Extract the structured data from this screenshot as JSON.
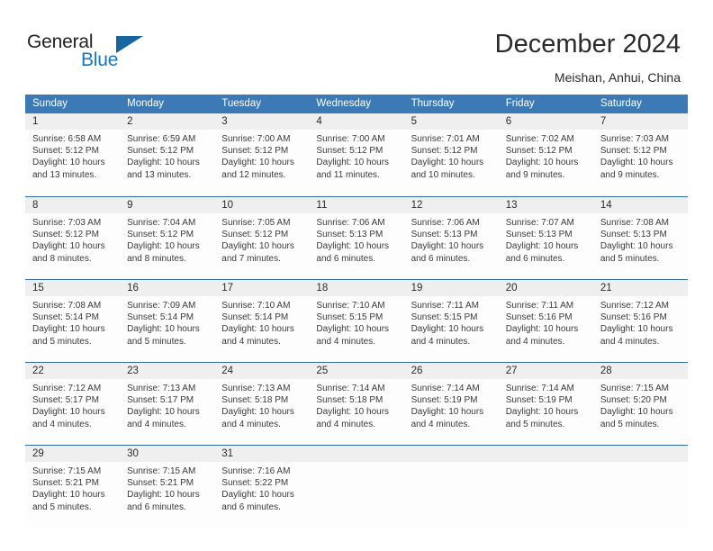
{
  "brand": {
    "line1": "General",
    "line2": "Blue",
    "triangle_color": "#16659f",
    "blue_color": "#1577c4"
  },
  "header": {
    "title": "December 2024",
    "subtitle": "Meishan, Anhui, China"
  },
  "theme": {
    "header_blue": "#3b7ab4",
    "row_rule_blue": "#2e6ca4",
    "date_band": "#efefef"
  },
  "weekdays": [
    "Sunday",
    "Monday",
    "Tuesday",
    "Wednesday",
    "Thursday",
    "Friday",
    "Saturday"
  ],
  "weeks": [
    [
      {
        "day": "1",
        "sunrise": "Sunrise: 6:58 AM",
        "sunset": "Sunset: 5:12 PM",
        "daylight1": "Daylight: 10 hours",
        "daylight2": "and 13 minutes."
      },
      {
        "day": "2",
        "sunrise": "Sunrise: 6:59 AM",
        "sunset": "Sunset: 5:12 PM",
        "daylight1": "Daylight: 10 hours",
        "daylight2": "and 13 minutes."
      },
      {
        "day": "3",
        "sunrise": "Sunrise: 7:00 AM",
        "sunset": "Sunset: 5:12 PM",
        "daylight1": "Daylight: 10 hours",
        "daylight2": "and 12 minutes."
      },
      {
        "day": "4",
        "sunrise": "Sunrise: 7:00 AM",
        "sunset": "Sunset: 5:12 PM",
        "daylight1": "Daylight: 10 hours",
        "daylight2": "and 11 minutes."
      },
      {
        "day": "5",
        "sunrise": "Sunrise: 7:01 AM",
        "sunset": "Sunset: 5:12 PM",
        "daylight1": "Daylight: 10 hours",
        "daylight2": "and 10 minutes."
      },
      {
        "day": "6",
        "sunrise": "Sunrise: 7:02 AM",
        "sunset": "Sunset: 5:12 PM",
        "daylight1": "Daylight: 10 hours",
        "daylight2": "and 9 minutes."
      },
      {
        "day": "7",
        "sunrise": "Sunrise: 7:03 AM",
        "sunset": "Sunset: 5:12 PM",
        "daylight1": "Daylight: 10 hours",
        "daylight2": "and 9 minutes."
      }
    ],
    [
      {
        "day": "8",
        "sunrise": "Sunrise: 7:03 AM",
        "sunset": "Sunset: 5:12 PM",
        "daylight1": "Daylight: 10 hours",
        "daylight2": "and 8 minutes."
      },
      {
        "day": "9",
        "sunrise": "Sunrise: 7:04 AM",
        "sunset": "Sunset: 5:12 PM",
        "daylight1": "Daylight: 10 hours",
        "daylight2": "and 8 minutes."
      },
      {
        "day": "10",
        "sunrise": "Sunrise: 7:05 AM",
        "sunset": "Sunset: 5:12 PM",
        "daylight1": "Daylight: 10 hours",
        "daylight2": "and 7 minutes."
      },
      {
        "day": "11",
        "sunrise": "Sunrise: 7:06 AM",
        "sunset": "Sunset: 5:13 PM",
        "daylight1": "Daylight: 10 hours",
        "daylight2": "and 6 minutes."
      },
      {
        "day": "12",
        "sunrise": "Sunrise: 7:06 AM",
        "sunset": "Sunset: 5:13 PM",
        "daylight1": "Daylight: 10 hours",
        "daylight2": "and 6 minutes."
      },
      {
        "day": "13",
        "sunrise": "Sunrise: 7:07 AM",
        "sunset": "Sunset: 5:13 PM",
        "daylight1": "Daylight: 10 hours",
        "daylight2": "and 6 minutes."
      },
      {
        "day": "14",
        "sunrise": "Sunrise: 7:08 AM",
        "sunset": "Sunset: 5:13 PM",
        "daylight1": "Daylight: 10 hours",
        "daylight2": "and 5 minutes."
      }
    ],
    [
      {
        "day": "15",
        "sunrise": "Sunrise: 7:08 AM",
        "sunset": "Sunset: 5:14 PM",
        "daylight1": "Daylight: 10 hours",
        "daylight2": "and 5 minutes."
      },
      {
        "day": "16",
        "sunrise": "Sunrise: 7:09 AM",
        "sunset": "Sunset: 5:14 PM",
        "daylight1": "Daylight: 10 hours",
        "daylight2": "and 5 minutes."
      },
      {
        "day": "17",
        "sunrise": "Sunrise: 7:10 AM",
        "sunset": "Sunset: 5:14 PM",
        "daylight1": "Daylight: 10 hours",
        "daylight2": "and 4 minutes."
      },
      {
        "day": "18",
        "sunrise": "Sunrise: 7:10 AM",
        "sunset": "Sunset: 5:15 PM",
        "daylight1": "Daylight: 10 hours",
        "daylight2": "and 4 minutes."
      },
      {
        "day": "19",
        "sunrise": "Sunrise: 7:11 AM",
        "sunset": "Sunset: 5:15 PM",
        "daylight1": "Daylight: 10 hours",
        "daylight2": "and 4 minutes."
      },
      {
        "day": "20",
        "sunrise": "Sunrise: 7:11 AM",
        "sunset": "Sunset: 5:16 PM",
        "daylight1": "Daylight: 10 hours",
        "daylight2": "and 4 minutes."
      },
      {
        "day": "21",
        "sunrise": "Sunrise: 7:12 AM",
        "sunset": "Sunset: 5:16 PM",
        "daylight1": "Daylight: 10 hours",
        "daylight2": "and 4 minutes."
      }
    ],
    [
      {
        "day": "22",
        "sunrise": "Sunrise: 7:12 AM",
        "sunset": "Sunset: 5:17 PM",
        "daylight1": "Daylight: 10 hours",
        "daylight2": "and 4 minutes."
      },
      {
        "day": "23",
        "sunrise": "Sunrise: 7:13 AM",
        "sunset": "Sunset: 5:17 PM",
        "daylight1": "Daylight: 10 hours",
        "daylight2": "and 4 minutes."
      },
      {
        "day": "24",
        "sunrise": "Sunrise: 7:13 AM",
        "sunset": "Sunset: 5:18 PM",
        "daylight1": "Daylight: 10 hours",
        "daylight2": "and 4 minutes."
      },
      {
        "day": "25",
        "sunrise": "Sunrise: 7:14 AM",
        "sunset": "Sunset: 5:18 PM",
        "daylight1": "Daylight: 10 hours",
        "daylight2": "and 4 minutes."
      },
      {
        "day": "26",
        "sunrise": "Sunrise: 7:14 AM",
        "sunset": "Sunset: 5:19 PM",
        "daylight1": "Daylight: 10 hours",
        "daylight2": "and 4 minutes."
      },
      {
        "day": "27",
        "sunrise": "Sunrise: 7:14 AM",
        "sunset": "Sunset: 5:19 PM",
        "daylight1": "Daylight: 10 hours",
        "daylight2": "and 5 minutes."
      },
      {
        "day": "28",
        "sunrise": "Sunrise: 7:15 AM",
        "sunset": "Sunset: 5:20 PM",
        "daylight1": "Daylight: 10 hours",
        "daylight2": "and 5 minutes."
      }
    ],
    [
      {
        "day": "29",
        "sunrise": "Sunrise: 7:15 AM",
        "sunset": "Sunset: 5:21 PM",
        "daylight1": "Daylight: 10 hours",
        "daylight2": "and 5 minutes."
      },
      {
        "day": "30",
        "sunrise": "Sunrise: 7:15 AM",
        "sunset": "Sunset: 5:21 PM",
        "daylight1": "Daylight: 10 hours",
        "daylight2": "and 6 minutes."
      },
      {
        "day": "31",
        "sunrise": "Sunrise: 7:16 AM",
        "sunset": "Sunset: 5:22 PM",
        "daylight1": "Daylight: 10 hours",
        "daylight2": "and 6 minutes."
      },
      {
        "day": "",
        "sunrise": "",
        "sunset": "",
        "daylight1": "",
        "daylight2": ""
      },
      {
        "day": "",
        "sunrise": "",
        "sunset": "",
        "daylight1": "",
        "daylight2": ""
      },
      {
        "day": "",
        "sunrise": "",
        "sunset": "",
        "daylight1": "",
        "daylight2": ""
      },
      {
        "day": "",
        "sunrise": "",
        "sunset": "",
        "daylight1": "",
        "daylight2": ""
      }
    ]
  ]
}
